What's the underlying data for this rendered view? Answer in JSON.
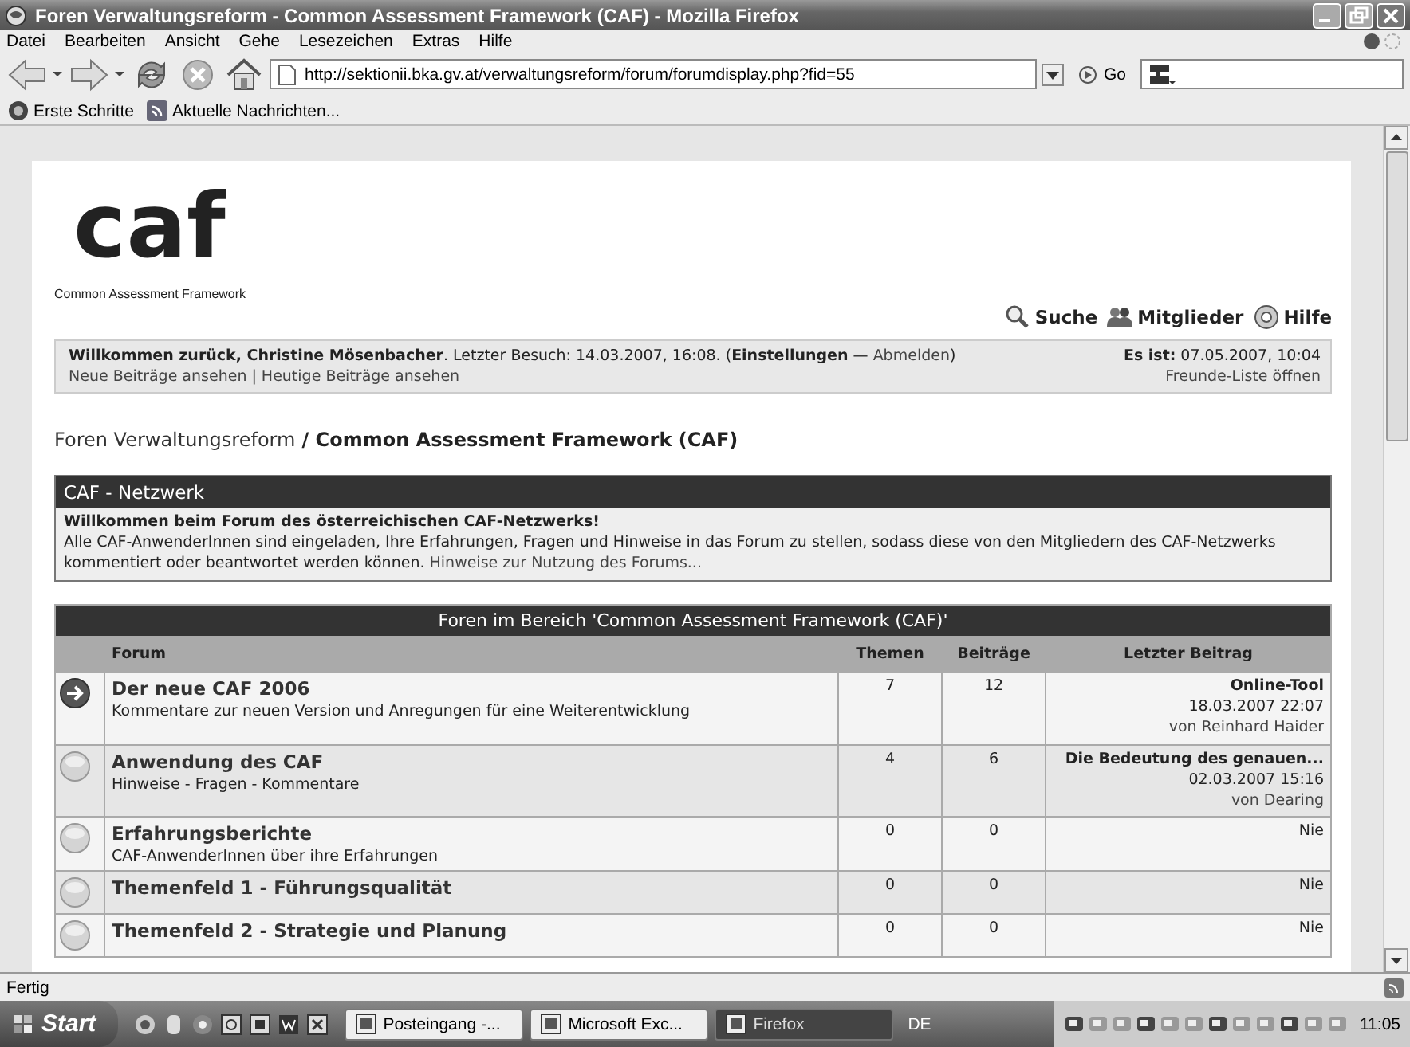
{
  "window": {
    "title": "Foren Verwaltungsreform - Common Assessment Framework (CAF) - Mozilla Firefox"
  },
  "menu": [
    "Datei",
    "Bearbeiten",
    "Ansicht",
    "Gehe",
    "Lesezeichen",
    "Extras",
    "Hilfe"
  ],
  "address": {
    "url": "http://sektionii.bka.gv.at/verwaltungsreform/forum/forumdisplay.php?fid=55",
    "go": "Go"
  },
  "bookmarks": [
    "Erste Schritte",
    "Aktuelle Nachrichten..."
  ],
  "page": {
    "logo": {
      "mark": "caf",
      "caption": "Common Assessment Framework"
    },
    "top_links": [
      {
        "label": "Suche",
        "kind": "search"
      },
      {
        "label": "Mitglieder",
        "kind": "members"
      },
      {
        "label": "Hilfe",
        "kind": "help"
      }
    ],
    "welcome": {
      "parts": [
        {
          "kind": "text",
          "text": "**Willkommen zurück, Christine Mösenbacher**. Letzter Besuch: 14.03.2007, 16:08. ("
        },
        {
          "kind": "link",
          "text": "Einstellungen",
          "bold": true
        },
        {
          "kind": "text",
          "text": " — "
        },
        {
          "kind": "link",
          "text": "Abmelden",
          "bold": false
        },
        {
          "kind": "text",
          "text": ")"
        }
      ],
      "links": [
        "Neue Beiträge ansehen",
        "Heutige Beiträge ansehen"
      ],
      "separator": "|",
      "time": "**Es ist:** 07.05.2007, 10:04",
      "friends": "Freunde-Liste öffnen"
    },
    "breadcrumb": [
      {
        "kind": "link",
        "text": "Foren Verwaltungsreform"
      },
      {
        "kind": "current",
        "text": "/ Common Assessment Framework (CAF)"
      }
    ],
    "notice": {
      "title": "CAF - Netzwerk",
      "heading": "Willkommen beim Forum des österreichischen CAF-Netzwerks!",
      "body": "Alle CAF-AnwenderInnen sind eingeladen, Ihre Erfahrungen, Fragen und Hinweise in das Forum zu stellen, sodass diese von den Mitgliedern des CAF-Netzwerks kommentiert oder beantwortet werden können.",
      "link": "Hinweise zur Nutzung des Forums..."
    },
    "table": {
      "title": "Foren im Bereich 'Common Assessment Framework (CAF)'",
      "columns": [
        "Forum",
        "Themen",
        "Beiträge",
        "Letzter Beitrag"
      ],
      "rows": [
        {
          "has_new": true,
          "title": "Der neue CAF 2006",
          "description": "Kommentare zur neuen Version und Anregungen für eine Weiterentwicklung",
          "topics": "7",
          "posts": "12",
          "last_post": {
            "title": "Online-Tool",
            "date": "18.03.2007 22:07",
            "by": "von Reinhard Haider"
          }
        },
        {
          "has_new": false,
          "title": "Anwendung des CAF",
          "description": "Hinweise - Fragen - Kommentare",
          "topics": "4",
          "posts": "6",
          "last_post": {
            "title": "Die Bedeutung des genauen...",
            "date": "02.03.2007 15:16",
            "by": "von Dearing"
          }
        },
        {
          "has_new": false,
          "title": "Erfahrungsberichte",
          "description": "CAF-AnwenderInnen über ihre Erfahrungen",
          "topics": "0",
          "posts": "0",
          "last_post": {
            "none": "Nie"
          }
        },
        {
          "has_new": false,
          "title": "Themenfeld 1 - Führungsqualität",
          "topics": "0",
          "posts": "0",
          "last_post": {
            "none": "Nie"
          }
        },
        {
          "has_new": false,
          "title": "Themenfeld 2 - Strategie und Planung",
          "topics": "0",
          "posts": "0",
          "last_post": {
            "none": "Nie"
          }
        }
      ]
    }
  },
  "status_bar": "Fertig",
  "taskbar": {
    "start": "Start",
    "tasks": [
      {
        "label": "Posteingang -...",
        "selected": false
      },
      {
        "label": "Microsoft Exc...",
        "selected": false
      },
      {
        "label": "Firefox",
        "selected": true
      }
    ],
    "language": "DE",
    "clock": "11:05"
  }
}
